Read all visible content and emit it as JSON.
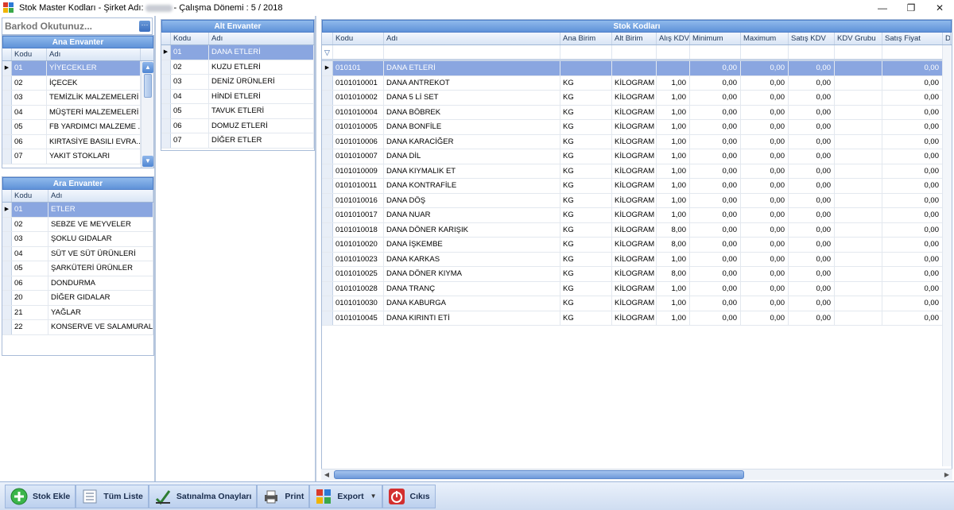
{
  "window": {
    "title_prefix": "Stok Master Kodları - Şirket Adı:",
    "title_suffix": "- Çalışma Dönemi : 5 / 2018",
    "minimize": "—",
    "restore": "❐",
    "close": "✕"
  },
  "barcode": {
    "placeholder": "Barkod Okutunuz...",
    "button": "···"
  },
  "ana_envanter": {
    "title": "Ana Envanter",
    "headers": [
      "Kodu",
      "Adı"
    ],
    "rows": [
      {
        "kodu": "01",
        "adi": "YİYECEKLER"
      },
      {
        "kodu": "02",
        "adi": "İÇECEK"
      },
      {
        "kodu": "03",
        "adi": "TEMİZLİK MALZEMELERİ"
      },
      {
        "kodu": "04",
        "adi": "MÜŞTERİ MALZEMELERİ"
      },
      {
        "kodu": "05",
        "adi": "FB YARDIMCI MALZEME ..."
      },
      {
        "kodu": "06",
        "adi": "KIRTASİYE BASILI EVRA..."
      },
      {
        "kodu": "07",
        "adi": "YAKIT STOKLARI"
      }
    ]
  },
  "ara_envanter": {
    "title": "Ara Envanter",
    "headers": [
      "Kodu",
      "Adı"
    ],
    "rows": [
      {
        "kodu": "01",
        "adi": "ETLER"
      },
      {
        "kodu": "02",
        "adi": "SEBZE VE MEYVELER"
      },
      {
        "kodu": "03",
        "adi": "ŞOKLU GIDALAR"
      },
      {
        "kodu": "04",
        "adi": "SÜT VE SÜT ÜRÜNLERİ"
      },
      {
        "kodu": "05",
        "adi": "ŞARKÜTERİ ÜRÜNLER"
      },
      {
        "kodu": "06",
        "adi": "DONDURMA"
      },
      {
        "kodu": "20",
        "adi": "DİĞER GIDALAR"
      },
      {
        "kodu": "21",
        "adi": "YAĞLAR"
      },
      {
        "kodu": "22",
        "adi": "KONSERVE VE SALAMURALAR"
      }
    ]
  },
  "alt_envanter": {
    "title": "Alt Envanter",
    "headers": [
      "Kodu",
      "Adı"
    ],
    "rows": [
      {
        "kodu": "01",
        "adi": "DANA ETLERİ"
      },
      {
        "kodu": "02",
        "adi": "KUZU ETLERİ"
      },
      {
        "kodu": "03",
        "adi": "DENİZ ÜRÜNLERİ"
      },
      {
        "kodu": "04",
        "adi": "HİNDİ ETLERİ"
      },
      {
        "kodu": "05",
        "adi": "TAVUK ETLERİ"
      },
      {
        "kodu": "06",
        "adi": "DOMUZ ETLERİ"
      },
      {
        "kodu": "07",
        "adi": "DİĞER ETLER"
      }
    ]
  },
  "stok_kodlari": {
    "title": "Stok Kodları",
    "headers": [
      "Kodu",
      "Adı",
      "Ana Birim",
      "Alt Birim",
      "Alış KDV",
      "Minimum",
      "Maximum",
      "Satış KDV",
      "KDV Grubu",
      "Satış Fiyat",
      "Do"
    ],
    "filter_icon": "▽",
    "rows": [
      {
        "kodu": "010101",
        "adi": "DANA ETLERİ",
        "ana": "",
        "alt": "",
        "alis": "",
        "min": "0,00",
        "max": "0,00",
        "satis_kdv": "0,00",
        "grup": "",
        "fiyat": "0,00"
      },
      {
        "kodu": "0101010001",
        "adi": "DANA ANTREKOT",
        "ana": "KG",
        "alt": "KİLOGRAM",
        "alis": "1,00",
        "min": "0,00",
        "max": "0,00",
        "satis_kdv": "0,00",
        "grup": "",
        "fiyat": "0,00"
      },
      {
        "kodu": "0101010002",
        "adi": "DANA 5 Lİ SET",
        "ana": "KG",
        "alt": "KİLOGRAM",
        "alis": "1,00",
        "min": "0,00",
        "max": "0,00",
        "satis_kdv": "0,00",
        "grup": "",
        "fiyat": "0,00"
      },
      {
        "kodu": "0101010004",
        "adi": "DANA BÖBREK",
        "ana": "KG",
        "alt": "KİLOGRAM",
        "alis": "1,00",
        "min": "0,00",
        "max": "0,00",
        "satis_kdv": "0,00",
        "grup": "",
        "fiyat": "0,00"
      },
      {
        "kodu": "0101010005",
        "adi": "DANA BONFİLE",
        "ana": "KG",
        "alt": "KİLOGRAM",
        "alis": "1,00",
        "min": "0,00",
        "max": "0,00",
        "satis_kdv": "0,00",
        "grup": "",
        "fiyat": "0,00"
      },
      {
        "kodu": "0101010006",
        "adi": "DANA KARACİĞER",
        "ana": "KG",
        "alt": "KİLOGRAM",
        "alis": "1,00",
        "min": "0,00",
        "max": "0,00",
        "satis_kdv": "0,00",
        "grup": "",
        "fiyat": "0,00"
      },
      {
        "kodu": "0101010007",
        "adi": "DANA DİL",
        "ana": "KG",
        "alt": "KİLOGRAM",
        "alis": "1,00",
        "min": "0,00",
        "max": "0,00",
        "satis_kdv": "0,00",
        "grup": "",
        "fiyat": "0,00"
      },
      {
        "kodu": "0101010009",
        "adi": "DANA KIYMALIK ET",
        "ana": "KG",
        "alt": "KİLOGRAM",
        "alis": "1,00",
        "min": "0,00",
        "max": "0,00",
        "satis_kdv": "0,00",
        "grup": "",
        "fiyat": "0,00"
      },
      {
        "kodu": "0101010011",
        "adi": "DANA KONTRAFİLE",
        "ana": "KG",
        "alt": "KİLOGRAM",
        "alis": "1,00",
        "min": "0,00",
        "max": "0,00",
        "satis_kdv": "0,00",
        "grup": "",
        "fiyat": "0,00"
      },
      {
        "kodu": "0101010016",
        "adi": "DANA DÖŞ",
        "ana": "KG",
        "alt": "KİLOGRAM",
        "alis": "1,00",
        "min": "0,00",
        "max": "0,00",
        "satis_kdv": "0,00",
        "grup": "",
        "fiyat": "0,00"
      },
      {
        "kodu": "0101010017",
        "adi": "DANA NUAR",
        "ana": "KG",
        "alt": "KİLOGRAM",
        "alis": "1,00",
        "min": "0,00",
        "max": "0,00",
        "satis_kdv": "0,00",
        "grup": "",
        "fiyat": "0,00"
      },
      {
        "kodu": "0101010018",
        "adi": "DANA DÖNER KARIŞIK",
        "ana": "KG",
        "alt": "KİLOGRAM",
        "alis": "8,00",
        "min": "0,00",
        "max": "0,00",
        "satis_kdv": "0,00",
        "grup": "",
        "fiyat": "0,00"
      },
      {
        "kodu": "0101010020",
        "adi": "DANA İŞKEMBE",
        "ana": "KG",
        "alt": "KİLOGRAM",
        "alis": "8,00",
        "min": "0,00",
        "max": "0,00",
        "satis_kdv": "0,00",
        "grup": "",
        "fiyat": "0,00"
      },
      {
        "kodu": "0101010023",
        "adi": "DANA KARKAS",
        "ana": "KG",
        "alt": "KİLOGRAM",
        "alis": "1,00",
        "min": "0,00",
        "max": "0,00",
        "satis_kdv": "0,00",
        "grup": "",
        "fiyat": "0,00"
      },
      {
        "kodu": "0101010025",
        "adi": "DANA DÖNER KIYMA",
        "ana": "KG",
        "alt": "KİLOGRAM",
        "alis": "8,00",
        "min": "0,00",
        "max": "0,00",
        "satis_kdv": "0,00",
        "grup": "",
        "fiyat": "0,00"
      },
      {
        "kodu": "0101010028",
        "adi": "DANA TRANÇ",
        "ana": "KG",
        "alt": "KİLOGRAM",
        "alis": "1,00",
        "min": "0,00",
        "max": "0,00",
        "satis_kdv": "0,00",
        "grup": "",
        "fiyat": "0,00"
      },
      {
        "kodu": "0101010030",
        "adi": "DANA KABURGA",
        "ana": "KG",
        "alt": "KİLOGRAM",
        "alis": "1,00",
        "min": "0,00",
        "max": "0,00",
        "satis_kdv": "0,00",
        "grup": "",
        "fiyat": "0,00"
      },
      {
        "kodu": "0101010045",
        "adi": "DANA KIRINTI ETİ",
        "ana": "KG",
        "alt": "KİLOGRAM",
        "alis": "1,00",
        "min": "0,00",
        "max": "0,00",
        "satis_kdv": "0,00",
        "grup": "",
        "fiyat": "0,00"
      }
    ]
  },
  "toolbar": {
    "stok_ekle": "Stok Ekle",
    "tum_liste": "Tüm Liste",
    "satinalma": "Satınalma Onayları",
    "print": "Print",
    "export": "Export",
    "cikis": "Cıkıs"
  },
  "colors": {
    "panel_header": "#6b9ade",
    "selected_row": "#8aa6e0",
    "toolbar_bg": "#d6e3f4"
  }
}
